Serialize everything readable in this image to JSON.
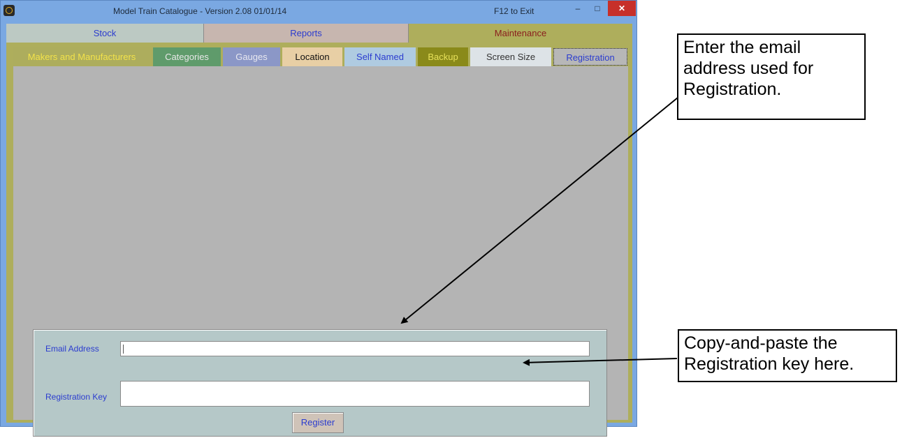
{
  "window": {
    "title": "Model Train Catalogue -  Version 2.08  01/01/14",
    "title_exit_hint": "F12 to Exit",
    "min_glyph": "–",
    "max_glyph": "□",
    "close_glyph": "✕"
  },
  "top_tabs": [
    {
      "label": "Stock"
    },
    {
      "label": "Reports"
    },
    {
      "label": "Maintenance",
      "active": true
    }
  ],
  "sub_tabs": [
    {
      "label": "Makers and Manufacturers"
    },
    {
      "label": "Categories"
    },
    {
      "label": "Gauges"
    },
    {
      "label": "Location"
    },
    {
      "label": "Self Named"
    },
    {
      "label": "Backup"
    },
    {
      "label": "Screen Size"
    },
    {
      "label": "Registration",
      "active": true
    }
  ],
  "registration": {
    "email_label": "Email Address",
    "email_value": "",
    "key_label": "Registration Key",
    "key_value": "",
    "register_button": "Register"
  },
  "callouts": {
    "email_note": "Enter the email address used for Registration.",
    "key_note": "Copy-and-paste the Registration key here."
  },
  "icons": [
    "app-icon",
    "minimize-icon",
    "maximize-icon",
    "close-icon"
  ]
}
